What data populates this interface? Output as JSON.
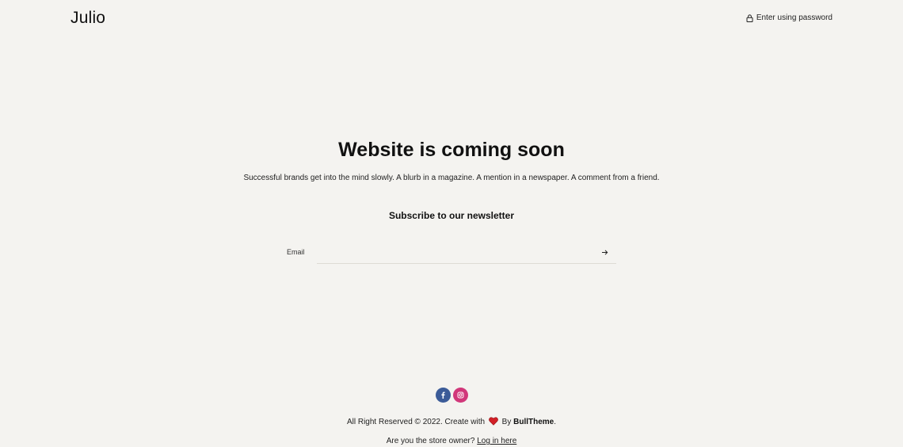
{
  "header": {
    "logo": "Julio",
    "password_link": "Enter using password"
  },
  "hero": {
    "title": "Website is coming soon",
    "text": "Successful brands get into the mind slowly. A blurb in a magazine. A mention in a newspaper. A comment from a friend."
  },
  "newsletter": {
    "heading": "Subscribe to our newsletter",
    "email_label": "Email",
    "email_value": "",
    "submit_icon": "arrow-right-icon"
  },
  "socials": [
    {
      "name": "facebook-icon",
      "color": "#3b5b98"
    },
    {
      "name": "instagram-icon",
      "color": "#d1377a"
    }
  ],
  "footer": {
    "copyright_prefix": "All Right Reserved © 2022. Create with",
    "heart_icon": "heart-icon",
    "by_text": "By",
    "brand": "BullTheme",
    "period": ".",
    "owner_question": "Are you the store owner?",
    "login_link": "Log in here"
  },
  "colors": {
    "background": "#f4f3f0",
    "heart": "#d21f26",
    "text": "#111111"
  }
}
